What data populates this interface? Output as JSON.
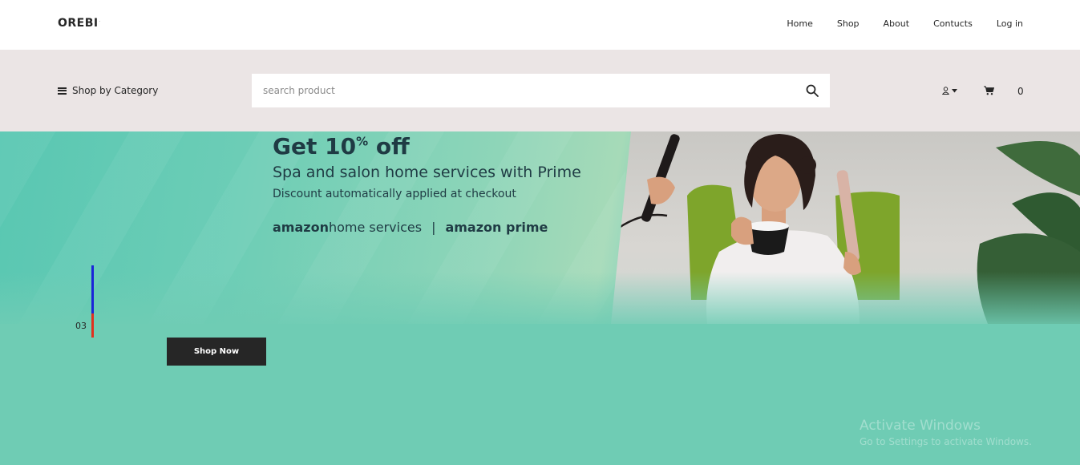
{
  "brand": {
    "name": "OREBI",
    "superscript": "."
  },
  "nav": {
    "links": [
      {
        "label": "Home"
      },
      {
        "label": "Shop"
      },
      {
        "label": "About"
      },
      {
        "label": "Contucts"
      },
      {
        "label": "Log in"
      }
    ]
  },
  "toolbar": {
    "category_label": "Shop by Category",
    "search_placeholder": "search product",
    "cart_count": "0"
  },
  "banner": {
    "headline_prefix": "Get 10",
    "headline_sup": "%",
    "headline_suffix": " off",
    "subheading": "Spa and salon home services with Prime",
    "note": "Discount automatically applied at checkout",
    "brand_1_bold": "amazon",
    "brand_1_rest": "home services",
    "separator": "|",
    "brand_2": "amazon prime",
    "slide_number": "03",
    "shop_button": "Shop Now",
    "colors": {
      "background": "#6fccb4",
      "headline": "#1f3b44",
      "indicator_active": "#1a25d8",
      "indicator_progress": "#e0301e"
    }
  },
  "system_overlay": {
    "line1": "Activate Windows",
    "line2": "Go to Settings to activate Windows."
  }
}
